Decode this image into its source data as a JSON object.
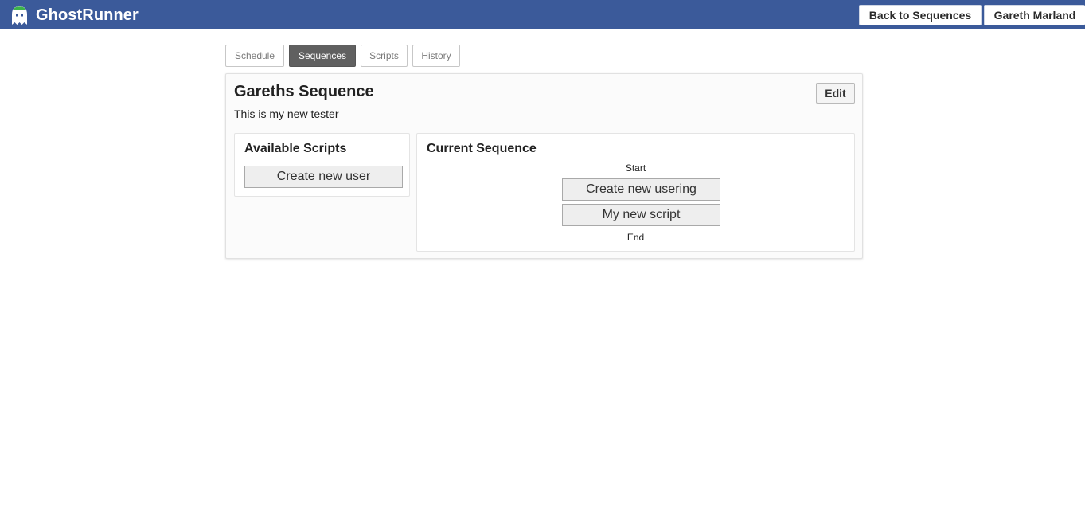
{
  "app": {
    "title": "GhostRunner",
    "brand_color": "#3b5a9a",
    "logo_icon": "ghost-icon",
    "logo_accent_color": "#3cb44a"
  },
  "header": {
    "back_label": "Back to Sequences",
    "user_label": "Gareth Marland"
  },
  "tabs": [
    {
      "label": "Schedule",
      "active": false
    },
    {
      "label": "Sequences",
      "active": true
    },
    {
      "label": "Scripts",
      "active": false
    },
    {
      "label": "History",
      "active": false
    }
  ],
  "sequence": {
    "title": "Gareths Sequence",
    "description": "This is my new tester",
    "edit_label": "Edit"
  },
  "available_scripts": {
    "heading": "Available Scripts",
    "items": [
      "Create new user"
    ]
  },
  "current_sequence": {
    "heading": "Current Sequence",
    "start_label": "Start",
    "end_label": "End",
    "items": [
      "Create new usering",
      "My new script"
    ]
  }
}
